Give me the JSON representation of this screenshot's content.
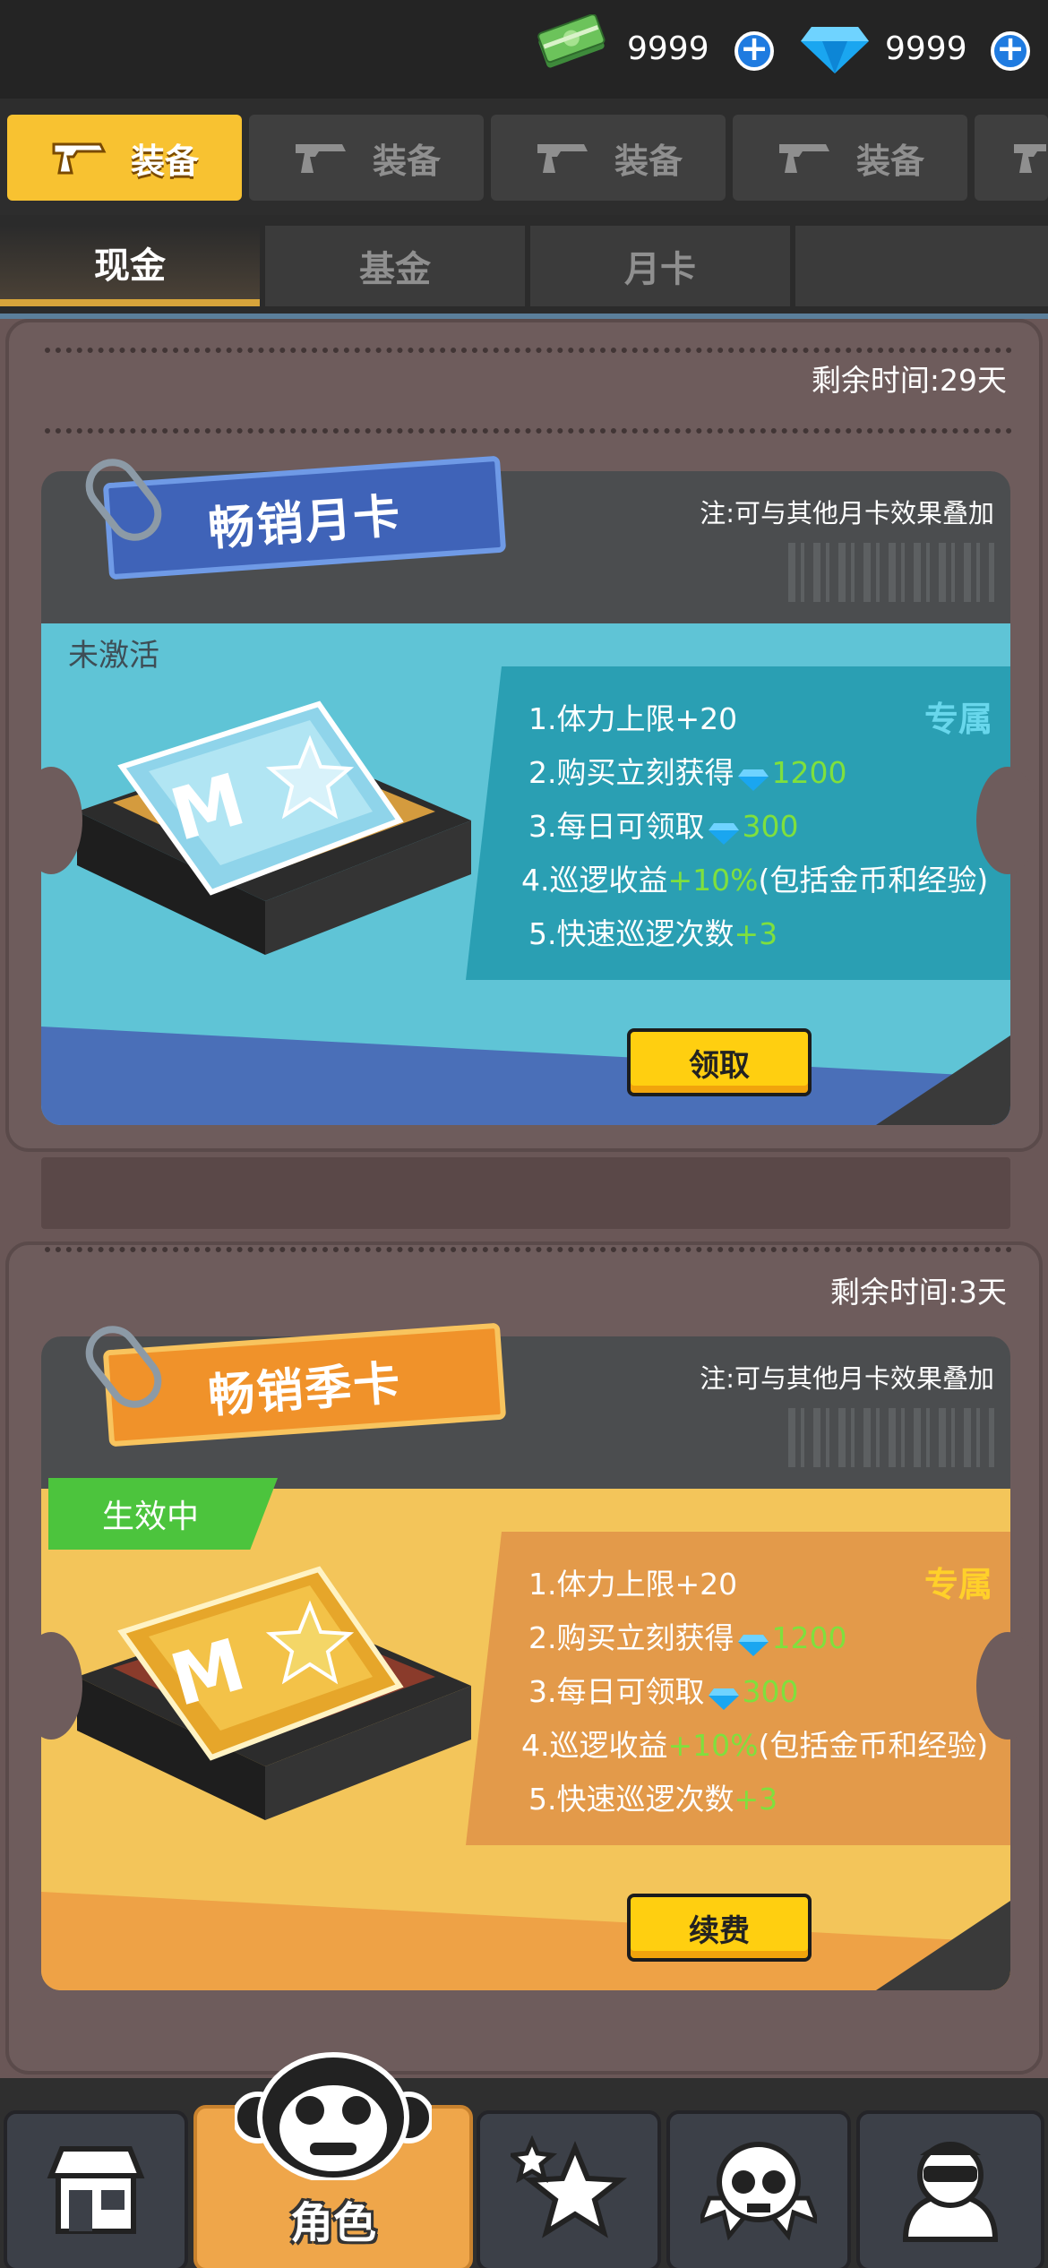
{
  "currency": {
    "cash": {
      "icon": "cash-stack-icon",
      "value": "9999"
    },
    "gems": {
      "icon": "diamond-icon",
      "value": "9999"
    }
  },
  "main_tabs": [
    {
      "label": "装备",
      "icon": "gun-icon",
      "active": true
    },
    {
      "label": "装备",
      "icon": "gun-icon",
      "active": false
    },
    {
      "label": "装备",
      "icon": "gun-icon",
      "active": false
    },
    {
      "label": "装备",
      "icon": "gun-icon",
      "active": false
    }
  ],
  "sub_tabs": [
    {
      "label": "现金",
      "active": true
    },
    {
      "label": "基金",
      "active": false
    },
    {
      "label": "月卡",
      "active": false
    },
    {
      "label": "",
      "active": false
    }
  ],
  "cards": [
    {
      "remaining": "剩余时间:29天",
      "note": "注:可与其他月卡效果叠加",
      "title": "畅销月卡",
      "status": "未激活",
      "exclusive": "专属",
      "b1": "1.体力上限+20",
      "b2_prefix": "2.购买立刻获得",
      "b2_value": "1200",
      "b3_prefix": "3.每日可领取",
      "b3_value": "300",
      "b4_prefix": "4.巡逻收益",
      "b4_highlight": "+10%",
      "b4_suffix": "(包括金币和经验)",
      "b5_prefix": "5.快速巡逻次数",
      "b5_highlight": "+3",
      "button": "领取"
    },
    {
      "remaining": "剩余时间:3天",
      "note": "注:可与其他月卡效果叠加",
      "title": "畅销季卡",
      "status": "生效中",
      "exclusive": "专属",
      "b1": "1.体力上限+20",
      "b2_prefix": "2.购买立刻获得",
      "b2_value": "1200",
      "b3_prefix": "3.每日可领取",
      "b3_value": "300",
      "b4_prefix": "4.巡逻收益",
      "b4_highlight": "+10%",
      "b4_suffix": "(包括金币和经验)",
      "b5_prefix": "5.快速巡逻次数",
      "b5_highlight": "+3",
      "button": "续费"
    }
  ],
  "colors": {
    "monthly_accent": "#5fc4d6",
    "seasonal_accent": "#f3c55a",
    "button_yellow": "#ffcf10",
    "green_text": "#7fe03d"
  },
  "bottom_nav": [
    {
      "icon": "shop-icon",
      "label": ""
    },
    {
      "icon": "monkey-face-icon",
      "label": "角色",
      "active": true
    },
    {
      "icon": "stars-icon",
      "label": ""
    },
    {
      "icon": "skull-icon",
      "label": ""
    },
    {
      "icon": "team-icon",
      "label": ""
    }
  ]
}
